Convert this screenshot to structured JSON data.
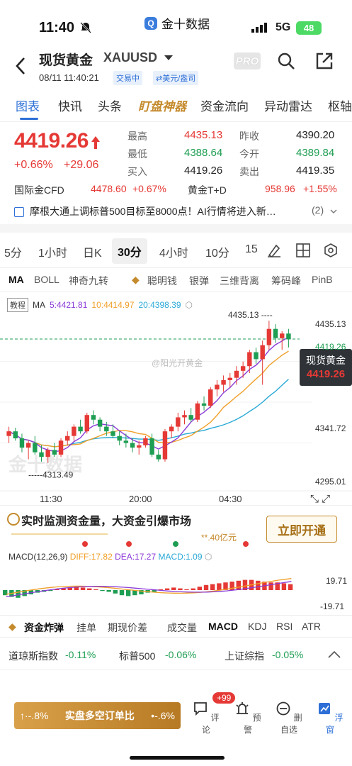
{
  "status": {
    "time": "11:40",
    "app_name": "金十数据",
    "network": "5G",
    "battery": "48"
  },
  "header": {
    "name": "现货黄金",
    "code": "XAUUSD",
    "datetime": "08/11 11:40:21",
    "badge_trading": "交易中",
    "badge_unit": "⇄美元/盎司",
    "pro_label": "PRO"
  },
  "tabs": [
    "图表",
    "快讯",
    "头条",
    "盯盘神器",
    "资金流向",
    "异动雷达",
    "枢轴"
  ],
  "quote": {
    "price": "4419.26",
    "change_pct": "+0.66%",
    "change": "+29.06",
    "high_label": "最高",
    "high": "4435.13",
    "low_label": "最低",
    "low": "4388.64",
    "buy_label": "买入",
    "buy": "4419.26",
    "prev_label": "昨收",
    "prev": "4390.20",
    "open_label": "今开",
    "open": "4389.84",
    "sell_label": "卖出",
    "sell": "4419.35"
  },
  "cfd": {
    "a_name": "国际金CFD",
    "a_price": "4478.60",
    "a_pct": "+0.67%",
    "b_name": "黄金T+D",
    "b_price": "958.96",
    "b_pct": "+1.55%"
  },
  "news": {
    "text": "摩根大通上调标普500目标至8000点！AI行情将进入新…",
    "count": "(2)"
  },
  "periods": [
    "5分",
    "1小时",
    "日K",
    "30分",
    "4小时",
    "10分",
    "15"
  ],
  "indicators": [
    "MA",
    "BOLL",
    "神奇九转",
    "聪明钱",
    "银弹",
    "三维背离",
    "筹码峰",
    "PinB"
  ],
  "ma": {
    "tutorial": "教程",
    "label": "MA",
    "ma5": "5:4421.81",
    "ma10": "10:4414.97",
    "ma20": "20:4398.39"
  },
  "chart_data": {
    "type": "candlestick",
    "x_ticks": [
      "11:30",
      "20:00",
      "04:30"
    ],
    "y_ticks": [
      4435.13,
      4419.26,
      4341.72,
      4295.01
    ],
    "ylim": [
      4295.01,
      4435.13
    ],
    "high_annotation": "4435.13",
    "low_annotation": "4313.49",
    "current_price_label": "4419.26",
    "current_name": "现货黄金",
    "watermark": "金十数据",
    "weibo_watermark": "@阳光开黄金",
    "ohlc": [
      [
        4336,
        4344,
        4330,
        4340
      ],
      [
        4340,
        4343,
        4332,
        4334
      ],
      [
        4334,
        4338,
        4322,
        4326
      ],
      [
        4326,
        4332,
        4316,
        4330
      ],
      [
        4330,
        4336,
        4320,
        4322
      ],
      [
        4322,
        4328,
        4314,
        4318
      ],
      [
        4318,
        4326,
        4313,
        4324
      ],
      [
        4324,
        4330,
        4318,
        4320
      ],
      [
        4320,
        4334,
        4318,
        4332
      ],
      [
        4332,
        4340,
        4328,
        4336
      ],
      [
        4336,
        4346,
        4332,
        4344
      ],
      [
        4344,
        4350,
        4338,
        4340
      ],
      [
        4340,
        4356,
        4338,
        4354
      ],
      [
        4354,
        4358,
        4346,
        4350
      ],
      [
        4350,
        4352,
        4340,
        4344
      ],
      [
        4344,
        4348,
        4336,
        4340
      ],
      [
        4340,
        4346,
        4334,
        4336
      ],
      [
        4336,
        4340,
        4328,
        4332
      ],
      [
        4332,
        4338,
        4326,
        4330
      ],
      [
        4330,
        4334,
        4322,
        4326
      ],
      [
        4326,
        4332,
        4320,
        4328
      ],
      [
        4328,
        4336,
        4326,
        4334
      ],
      [
        4334,
        4338,
        4318,
        4320
      ],
      [
        4320,
        4324,
        4314,
        4316
      ],
      [
        4316,
        4342,
        4314,
        4340
      ],
      [
        4340,
        4346,
        4334,
        4344
      ],
      [
        4344,
        4356,
        4340,
        4352
      ],
      [
        4352,
        4358,
        4346,
        4354
      ],
      [
        4354,
        4360,
        4348,
        4350
      ],
      [
        4350,
        4366,
        4348,
        4364
      ],
      [
        4364,
        4370,
        4358,
        4362
      ],
      [
        4362,
        4378,
        4360,
        4376
      ],
      [
        4376,
        4384,
        4370,
        4380
      ],
      [
        4380,
        4388,
        4374,
        4384
      ],
      [
        4384,
        4390,
        4378,
        4386
      ],
      [
        4386,
        4396,
        4380,
        4392
      ],
      [
        4392,
        4400,
        4386,
        4396
      ],
      [
        4396,
        4410,
        4390,
        4408
      ],
      [
        4408,
        4412,
        4398,
        4402
      ],
      [
        4402,
        4418,
        4380,
        4414
      ],
      [
        4414,
        4435,
        4410,
        4428
      ],
      [
        4428,
        4432,
        4416,
        4420
      ],
      [
        4420,
        4426,
        4410,
        4424
      ],
      [
        4424,
        4428,
        4412,
        4419
      ]
    ]
  },
  "axes": {
    "r1": "4435.13",
    "r2": "4419.26",
    "r3": "4341.72",
    "r4": "4295.01"
  },
  "promo": {
    "title": "实时监测资金量，大资金引爆市场",
    "button": "立即开通",
    "sub": "**.40亿元"
  },
  "macd": {
    "label": "MACD(12,26,9)",
    "diff": "DIFF:17.82",
    "dea": "DEA:17.27",
    "macd": "MACD:1.09",
    "top": "19.71",
    "bottom": "-19.71"
  },
  "bottom_tabs": [
    "资金炸弹",
    "挂单",
    "期现价差",
    "成交量",
    "MACD",
    "KDJ",
    "RSI",
    "ATR"
  ],
  "indices": [
    {
      "name": "道琼斯指数",
      "pct": "-0.11%"
    },
    {
      "name": "标普500",
      "pct": "-0.06%"
    },
    {
      "name": "上证综指",
      "pct": "-0.05%"
    }
  ],
  "bottom_bar": {
    "banner_left": "↑·-.8%",
    "banner_text": "实盘多空订单比",
    "banner_right": "•-.6%",
    "comment": "评论",
    "badge": "+99",
    "alert": "预警",
    "remove": "删自选",
    "float": "浮窗"
  },
  "colors": {
    "up": "#e53935",
    "down": "#1e9e53",
    "accent": "#2d6fd6",
    "gold": "#c48a2c"
  }
}
